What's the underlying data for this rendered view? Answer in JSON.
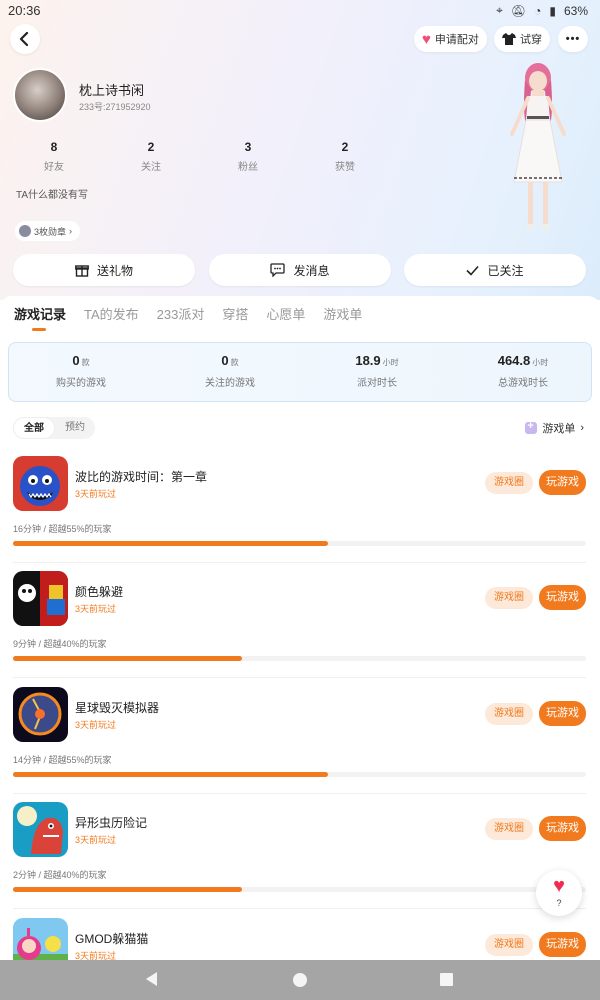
{
  "status_bar": {
    "time": "20:36",
    "battery": "63%"
  },
  "header": {
    "match_label": "申请配对",
    "tryon_label": "试穿",
    "more_label": "•••"
  },
  "profile": {
    "username": "枕上诗书闲",
    "user_id": "233号:271952920",
    "stats": [
      {
        "value": "8",
        "label": "好友"
      },
      {
        "value": "2",
        "label": "关注"
      },
      {
        "value": "3",
        "label": "粉丝"
      },
      {
        "value": "2",
        "label": "获赞"
      }
    ],
    "bio": "TA什么都没有写",
    "badge": "3枚勋章",
    "badge_chevron": "›"
  },
  "actions": {
    "gift": "送礼物",
    "message": "发消息",
    "followed": "已关注"
  },
  "tabs": [
    "游戏记录",
    "TA的发布",
    "233派对",
    "穿搭",
    "心愿单",
    "游戏单"
  ],
  "summary": [
    {
      "value": "0",
      "unit": "款",
      "label": "购买的游戏"
    },
    {
      "value": "0",
      "unit": "款",
      "label": "关注的游戏"
    },
    {
      "value": "18.9",
      "unit": "小时",
      "label": "派对时长"
    },
    {
      "value": "464.8",
      "unit": "小时",
      "label": "总游戏时长"
    }
  ],
  "filters": {
    "all": "全部",
    "reserve": "预约"
  },
  "gamelist_link": "游戏单",
  "gamelist_chevron": "›",
  "games": [
    {
      "name": "波比的游戏时间：第一章",
      "played": "3天前玩过",
      "duration": "16分钟 / 超越55%的玩家",
      "progress": 0.55,
      "circle": "游戏圈",
      "play": "玩游戏"
    },
    {
      "name": "颜色躲避",
      "played": "3天前玩过",
      "duration": "9分钟 / 超越40%的玩家",
      "progress": 0.4,
      "circle": "游戏圈",
      "play": "玩游戏"
    },
    {
      "name": "星球毁灭模拟器",
      "played": "3天前玩过",
      "duration": "14分钟 / 超越55%的玩家",
      "progress": 0.55,
      "circle": "游戏圈",
      "play": "玩游戏"
    },
    {
      "name": "异形虫历险记",
      "played": "3天前玩过",
      "duration": "2分钟 / 超越40%的玩家",
      "progress": 0.4,
      "circle": "游戏圈",
      "play": "玩游戏"
    },
    {
      "name": "GMOD躲猫猫",
      "played": "3天前玩过",
      "duration": "",
      "progress": 0,
      "circle": "游戏圈",
      "play": "玩游戏"
    }
  ],
  "floating": {
    "heart": "♥",
    "label": "?"
  },
  "colors": {
    "accent": "#f17a1e",
    "accent_light": "#fde9da",
    "heart": "#f02d4e"
  }
}
